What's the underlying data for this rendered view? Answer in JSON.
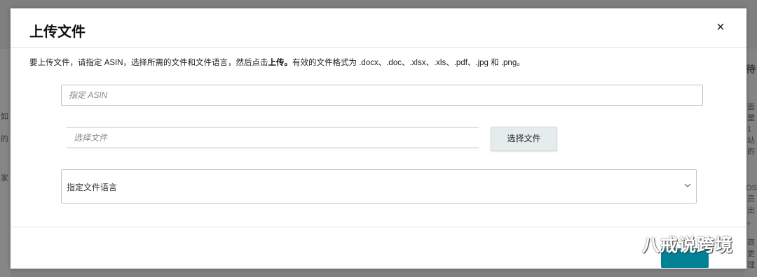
{
  "modal": {
    "title": "上传文件",
    "close_label": "×",
    "instructions": {
      "before": "要上传文件，请指定 ASIN，选择所需的文件和文件语言，然后点击",
      "action": "上传。",
      "after": "有效的文件格式为 .docx、.doc、.xlsx、.xls、.pdf、.jpg 和 .png。"
    },
    "asin_input": {
      "placeholder": "指定 ASIN",
      "value": ""
    },
    "file_input": {
      "placeholder": "选择文件",
      "value": ""
    },
    "choose_file_button": "选择文件",
    "language_select": {
      "selected": "指定文件语言"
    }
  },
  "background": {
    "right_fragments": [
      "待",
      "面",
      "量",
      "1",
      "站",
      "的",
      "OS",
      "员",
      "出",
      "。",
      "商",
      "更",
      "理"
    ],
    "left_fragments": [
      "如",
      "的",
      "家"
    ]
  },
  "watermark": {
    "text": "八戒说跨境",
    "icon": "wechat-icon"
  },
  "colors": {
    "primary": "#008296",
    "button_bg": "#e4ecec",
    "overlay": "#7f7f7f"
  }
}
